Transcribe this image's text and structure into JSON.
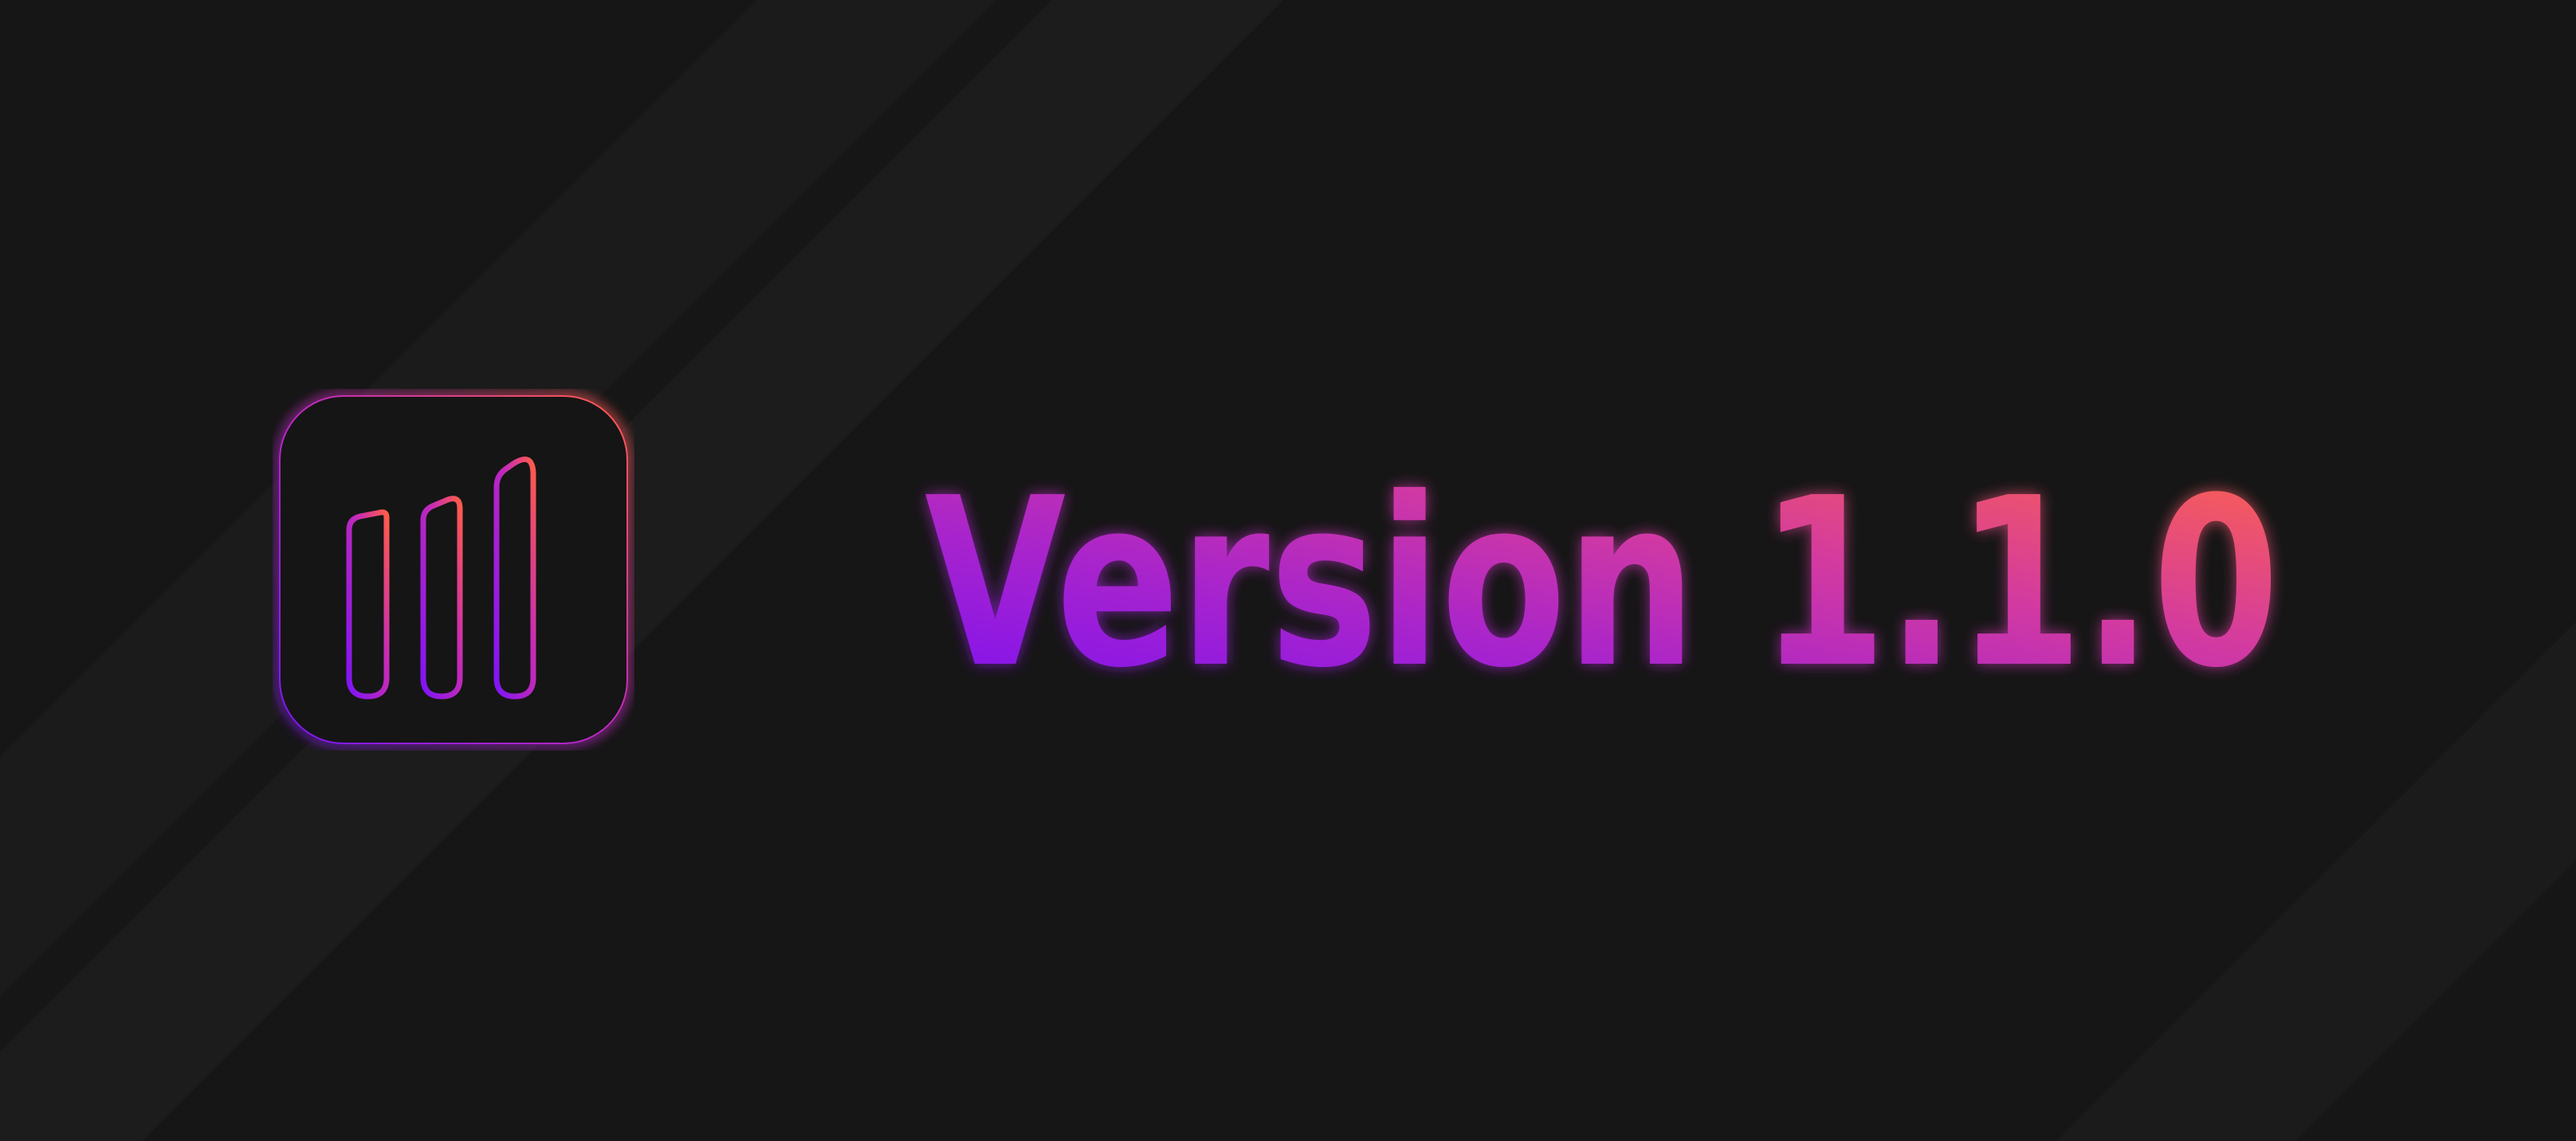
{
  "banner": {
    "version_label": "Version 1.1.0"
  },
  "colors": {
    "background": "#161616",
    "stripe": "#1c1c1c",
    "icon_tile": "#151515",
    "gradient_start": "#7a16f2",
    "gradient_mid": "#c22cb8",
    "gradient_end": "#ff5c4a"
  },
  "icons": {
    "app_icon": "signal-bars-icon"
  }
}
